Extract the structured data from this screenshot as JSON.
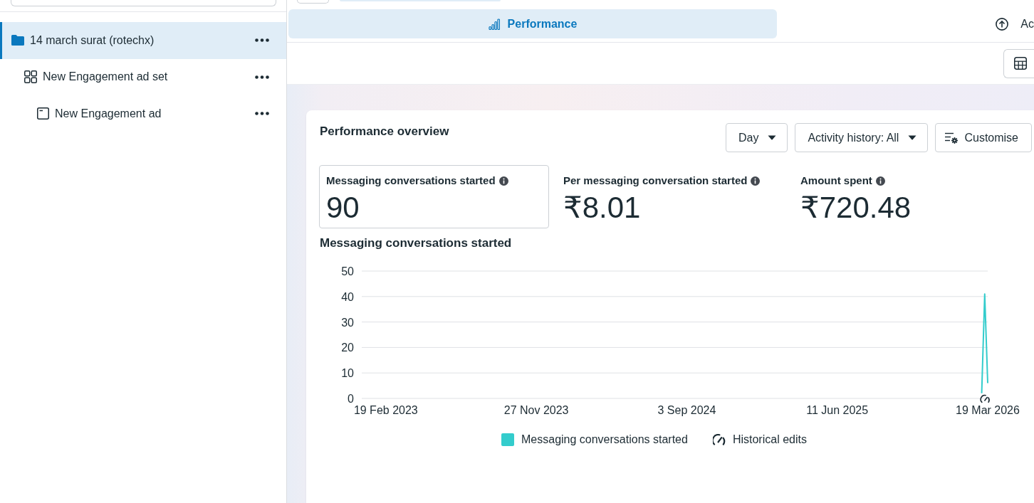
{
  "sidebar": {
    "tree": [
      {
        "kind": "campaign",
        "label": "14 march surat (rotechx)",
        "selected": true,
        "children": [
          {
            "kind": "ad_set",
            "label": "New Engagement ad set",
            "selected": false,
            "children": [
              {
                "kind": "ad",
                "label": "New Engagement ad",
                "selected": false
              }
            ]
          }
        ]
      }
    ]
  },
  "tabs": [
    {
      "label": "Performance",
      "selected": true
    },
    {
      "label": "Ac",
      "selected": false
    }
  ],
  "performance": {
    "title": "Performance overview",
    "controls": [
      {
        "kind": "dropdown",
        "label": "Day"
      },
      {
        "kind": "dropdown",
        "label": "Activity history: All"
      },
      {
        "kind": "button",
        "label": "Customise"
      }
    ],
    "metrics": [
      {
        "label": "Messaging conversations started",
        "value": "90",
        "selected": true
      },
      {
        "label": "Per messaging conversation started",
        "value": "₹8.01",
        "selected": false
      },
      {
        "label": "Amount spent",
        "value": "₹720.48",
        "selected": false
      }
    ],
    "chart": {
      "chart_data": {
        "type": "line",
        "title": "Messaging conversations started",
        "grid": true,
        "categories": [
          null,
          null,
          null,
          null,
          null,
          null,
          null,
          null,
          "19 Feb 2023",
          null,
          null,
          null,
          null,
          null,
          null,
          null,
          null,
          null,
          null,
          null,
          null,
          null,
          null,
          null,
          null,
          null,
          null,
          null,
          null,
          null,
          null,
          null,
          null,
          null,
          null,
          null,
          null,
          null,
          null,
          null,
          null,
          null,
          null,
          null,
          null,
          null,
          null,
          null,
          null,
          null,
          null,
          null,
          null,
          null,
          null,
          null,
          null,
          null,
          "27 Nov 2023",
          null,
          null,
          null,
          null,
          null,
          null,
          null,
          null,
          null,
          null,
          null,
          null,
          null,
          null,
          null,
          null,
          null,
          null,
          null,
          null,
          null,
          null,
          null,
          null,
          null,
          null,
          null,
          null,
          null,
          null,
          null,
          null,
          null,
          null,
          null,
          null,
          null,
          null,
          null,
          null,
          null,
          null,
          null,
          null,
          null,
          null,
          null,
          null,
          null,
          "3 Sep 2024",
          null,
          null,
          null,
          null,
          null,
          null,
          null,
          null,
          null,
          null,
          null,
          null,
          null,
          null,
          null,
          null,
          null,
          null,
          null,
          null,
          null,
          null,
          null,
          null,
          null,
          null,
          null,
          null,
          null,
          null,
          null,
          null,
          null,
          null,
          null,
          null,
          null,
          null,
          null,
          null,
          null,
          null,
          null,
          null,
          null,
          null,
          null,
          null,
          null,
          "11 Jun 2025",
          null,
          null,
          null,
          null,
          null,
          null,
          null,
          null,
          null,
          null,
          null,
          null,
          null,
          null,
          null,
          null,
          null,
          null,
          null,
          null,
          null,
          null,
          null,
          null,
          null,
          null,
          null,
          null,
          null,
          null,
          null,
          null,
          null,
          null,
          null,
          null,
          null,
          null,
          null,
          null,
          null,
          null,
          null,
          null,
          null,
          null,
          null,
          null,
          null,
          "19 Mar 2026"
        ],
        "series": [
          {
            "name": "Messaging conversations started",
            "color": "#33cccc",
            "values": [
              null,
              null,
              null,
              null,
              null,
              null,
              null,
              null,
              null,
              null,
              null,
              null,
              null,
              null,
              null,
              null,
              null,
              null,
              null,
              null,
              null,
              null,
              null,
              null,
              null,
              null,
              null,
              null,
              null,
              null,
              null,
              null,
              null,
              null,
              null,
              null,
              null,
              null,
              null,
              null,
              null,
              null,
              null,
              null,
              null,
              null,
              null,
              null,
              null,
              null,
              null,
              null,
              null,
              null,
              null,
              null,
              null,
              null,
              null,
              null,
              null,
              null,
              null,
              null,
              null,
              null,
              null,
              null,
              null,
              null,
              null,
              null,
              null,
              null,
              null,
              null,
              null,
              null,
              null,
              null,
              null,
              null,
              null,
              null,
              null,
              null,
              null,
              null,
              null,
              null,
              null,
              null,
              null,
              null,
              null,
              null,
              null,
              null,
              null,
              null,
              null,
              null,
              null,
              null,
              null,
              null,
              null,
              null,
              null,
              null,
              null,
              null,
              null,
              null,
              null,
              null,
              null,
              null,
              null,
              null,
              null,
              null,
              null,
              null,
              null,
              null,
              null,
              null,
              null,
              null,
              null,
              null,
              null,
              null,
              null,
              null,
              null,
              null,
              null,
              null,
              null,
              null,
              null,
              null,
              null,
              null,
              null,
              null,
              null,
              null,
              null,
              null,
              null,
              null,
              null,
              null,
              null,
              null,
              null,
              null,
              null,
              null,
              null,
              null,
              null,
              null,
              null,
              null,
              null,
              null,
              null,
              null,
              null,
              null,
              null,
              null,
              null,
              null,
              null,
              null,
              null,
              null,
              null,
              null,
              null,
              null,
              null,
              null,
              null,
              null,
              null,
              null,
              null,
              null,
              null,
              null,
              null,
              null,
              null,
              null,
              null,
              null,
              null,
              null,
              null,
              null,
              2,
              41,
              6
            ]
          }
        ],
        "ylim": [
          0,
          50
        ],
        "yticks": [
          0,
          10,
          20,
          30,
          40,
          50
        ]
      },
      "edits_label": "Historical edits"
    }
  }
}
